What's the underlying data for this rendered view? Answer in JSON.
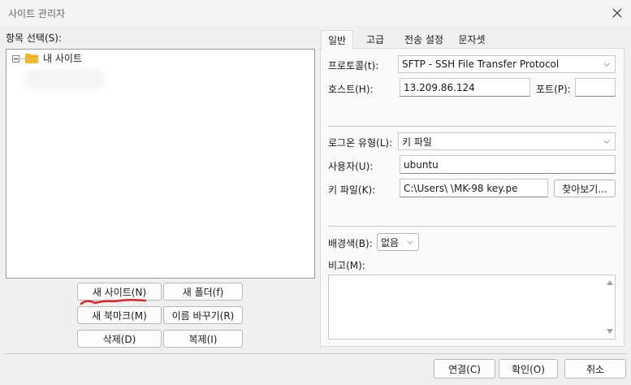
{
  "window": {
    "title": "사이트 관리자"
  },
  "left": {
    "tree_label": "항목 선택(S):",
    "tree_root": "내 사이트",
    "buttons": {
      "new_site": "새 사이트(N)",
      "new_folder": "새 폴더(f)",
      "new_bookmark": "새 북마크(M)",
      "rename": "이름 바꾸기(R)",
      "delete": "삭제(D)",
      "duplicate": "복제(I)"
    }
  },
  "tabs": [
    "일반",
    "고급",
    "전송 설정",
    "문자셋"
  ],
  "general": {
    "protocol_label": "프로토콜(t):",
    "protocol_value": "SFTP - SSH File Transfer Protocol",
    "host_label": "호스트(H):",
    "host_value": "13.209.86.124",
    "port_label": "포트(P):",
    "port_value": "",
    "logon_label": "로그온 유형(L):",
    "logon_value": "키 파일",
    "user_label": "사용자(U):",
    "user_value": "ubuntu",
    "keyfile_label": "키 파일(K):",
    "keyfile_value": "C:\\Users\\          \\MK-98 key.pe",
    "browse_label": "찾아보기...",
    "bgcolor_label": "배경색(B):",
    "bgcolor_value": "없음",
    "comment_label": "비고(M):",
    "comment_value": ""
  },
  "footer": {
    "connect": "연결(C)",
    "ok": "확인(O)",
    "cancel": "취소"
  },
  "colors": {
    "folder": "#f2b82e",
    "annotation": "#e5232b"
  }
}
